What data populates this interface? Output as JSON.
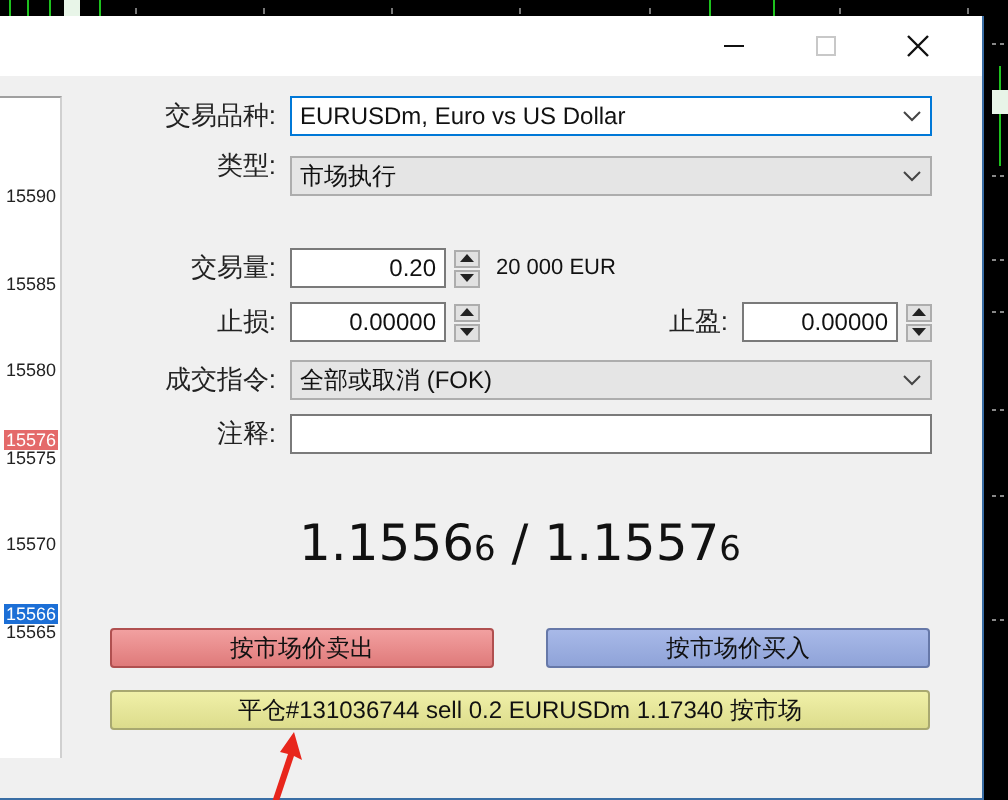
{
  "window": {
    "controls": [
      {
        "kind": "minimize",
        "disabled": false
      },
      {
        "kind": "maximize",
        "disabled": true
      },
      {
        "kind": "close",
        "disabled": false
      }
    ]
  },
  "price_axis": {
    "labels": [
      {
        "text": "15590"
      },
      {
        "text": "15585"
      },
      {
        "text": "15580"
      },
      {
        "text": "15576",
        "color": "#e46a6a"
      },
      {
        "text": "15575"
      },
      {
        "text": "15570"
      },
      {
        "text": "15566",
        "color": "#1c6fd6"
      },
      {
        "text": "15565"
      }
    ]
  },
  "form": {
    "symbol": {
      "label": "交易品种:",
      "value": "EURUSDm, Euro vs US Dollar",
      "focused": true
    },
    "type": {
      "label": "类型:",
      "value": "市场执行"
    },
    "volume": {
      "label": "交易量:",
      "value": "0.20",
      "note": "20 000 EUR"
    },
    "stop_loss": {
      "label": "止损:",
      "value": "0.00000"
    },
    "take_profit": {
      "label": "止盈:",
      "value": "0.00000"
    },
    "filling": {
      "label": "成交指令:",
      "value": "全部或取消 (FOK)"
    },
    "comment": {
      "label": "注释:"
    }
  },
  "quote": "1.1556$_{6}$ / 1.1557$_{6}$",
  "buttons": [
    {
      "kind": "sell",
      "label": "按市场价卖出"
    },
    {
      "kind": "buy",
      "label": "按市场价买入"
    },
    {
      "kind": "close",
      "label": "平仓#131036744 sell 0.2 EURUSDm 1.17340 按市场"
    }
  ]
}
